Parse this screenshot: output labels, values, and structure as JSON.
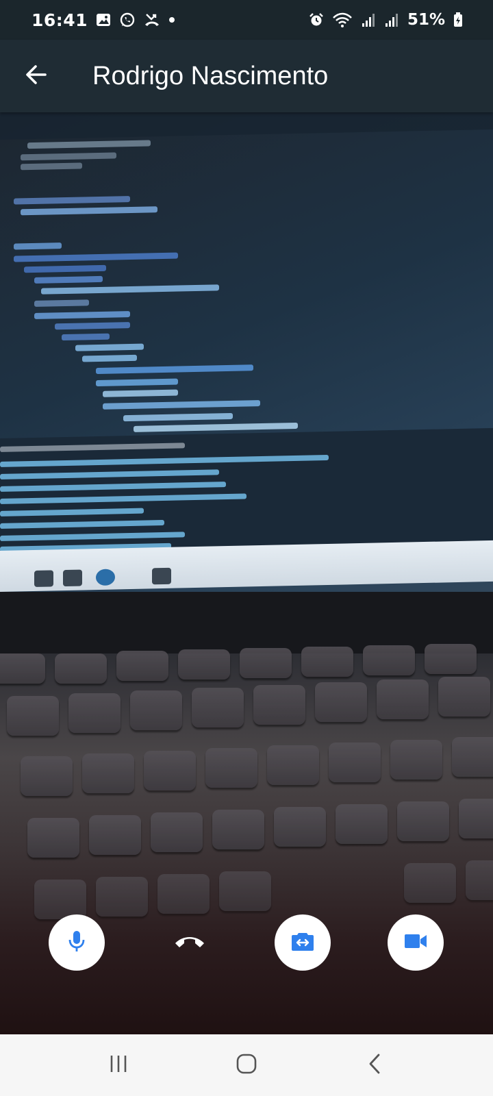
{
  "status_bar": {
    "time": "16:41",
    "left_icons": [
      "gallery-icon",
      "whatsapp-icon",
      "missed-call-icon",
      "dot-icon"
    ],
    "right_icons": [
      "alarm-icon",
      "wifi-icon",
      "signal-icon",
      "signal-icon",
      "battery-icon"
    ],
    "battery": "51%"
  },
  "app_bar": {
    "back_icon": "arrow-back-icon",
    "title": "Rodrigo Nascimento"
  },
  "video": {
    "description_icon": "remote-video-feed"
  },
  "controls": {
    "mute_icon": "microphone-icon",
    "end_call_icon": "call-end-icon",
    "switch_camera_icon": "switch-camera-icon",
    "video_icon": "videocam-icon",
    "accent": "#2f80ed"
  },
  "nav_bar": {
    "recents_icon": "recents-icon",
    "home_icon": "home-icon",
    "back_icon": "nav-back-icon"
  }
}
